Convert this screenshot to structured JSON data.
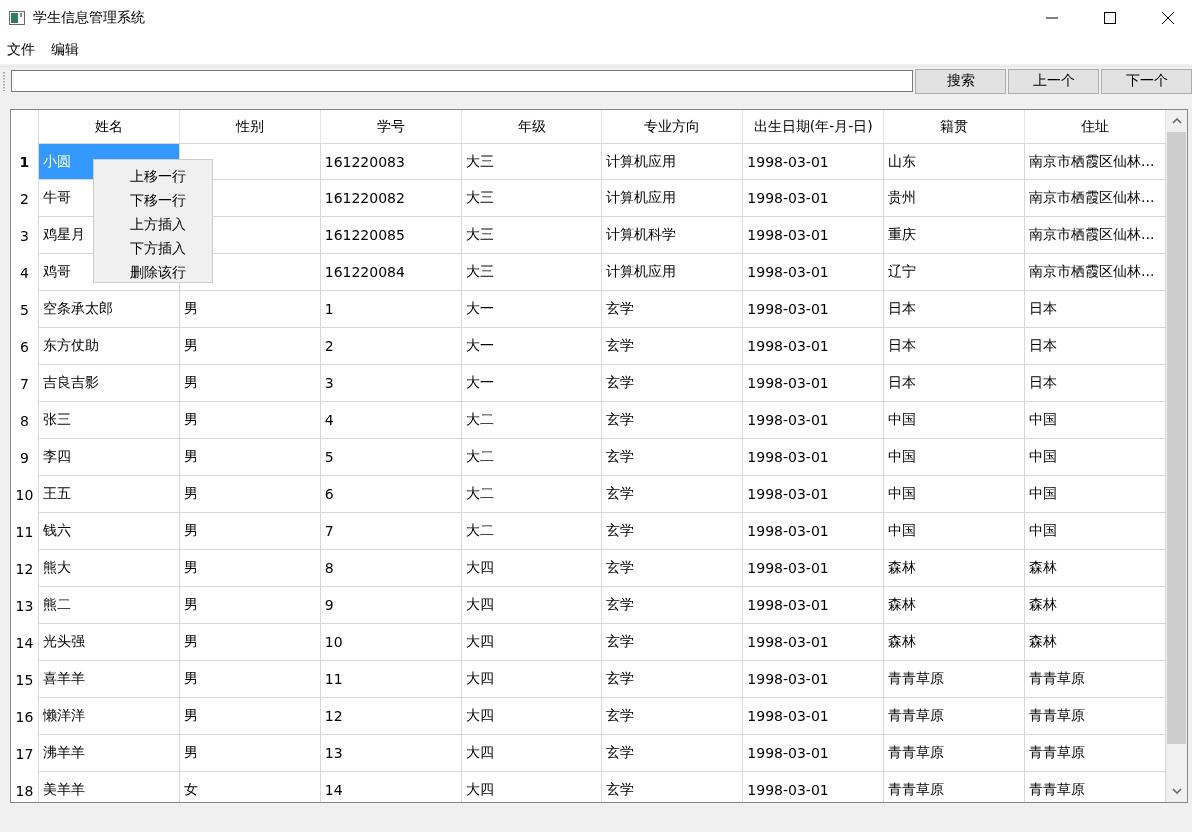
{
  "window": {
    "title": "学生信息管理系统"
  },
  "menu_bar": [
    "文件",
    "编辑"
  ],
  "toolbar": {
    "buttons": [
      "搜索",
      "上一个",
      "下一个"
    ]
  },
  "table": {
    "columns": [
      "姓名",
      "性别",
      "学号",
      "年级",
      "专业方向",
      "出生日期(年-月-日)",
      "籍贯",
      "住址"
    ],
    "rows": [
      {
        "number": "1",
        "selected": true,
        "cells": [
          "小圆",
          null,
          "161220083",
          "大三",
          "计算机应用",
          "1998-03-01",
          "山东",
          "南京市栖霞区仙林..."
        ]
      },
      {
        "number": "2",
        "selected": false,
        "cells": [
          "牛哥",
          null,
          "161220082",
          "大三",
          "计算机应用",
          "1998-03-01",
          "贵州",
          "南京市栖霞区仙林..."
        ]
      },
      {
        "number": "3",
        "selected": false,
        "cells": [
          "鸡星月",
          null,
          "161220085",
          "大三",
          "计算机科学",
          "1998-03-01",
          "重庆",
          "南京市栖霞区仙林..."
        ]
      },
      {
        "number": "4",
        "selected": false,
        "cells": [
          "鸡哥",
          null,
          "161220084",
          "大三",
          "计算机应用",
          "1998-03-01",
          "辽宁",
          "南京市栖霞区仙林..."
        ]
      },
      {
        "number": "5",
        "selected": false,
        "cells": [
          "空条承太郎",
          "男",
          "1",
          "大一",
          "玄学",
          "1998-03-01",
          "日本",
          "日本"
        ]
      },
      {
        "number": "6",
        "selected": false,
        "cells": [
          "东方仗助",
          "男",
          "2",
          "大一",
          "玄学",
          "1998-03-01",
          "日本",
          "日本"
        ]
      },
      {
        "number": "7",
        "selected": false,
        "cells": [
          "吉良吉影",
          "男",
          "3",
          "大一",
          "玄学",
          "1998-03-01",
          "日本",
          "日本"
        ]
      },
      {
        "number": "8",
        "selected": false,
        "cells": [
          "张三",
          "男",
          "4",
          "大二",
          "玄学",
          "1998-03-01",
          "中国",
          "中国"
        ]
      },
      {
        "number": "9",
        "selected": false,
        "cells": [
          "李四",
          "男",
          "5",
          "大二",
          "玄学",
          "1998-03-01",
          "中国",
          "中国"
        ]
      },
      {
        "number": "10",
        "selected": false,
        "cells": [
          "王五",
          "男",
          "6",
          "大二",
          "玄学",
          "1998-03-01",
          "中国",
          "中国"
        ]
      },
      {
        "number": "11",
        "selected": false,
        "cells": [
          "钱六",
          "男",
          "7",
          "大二",
          "玄学",
          "1998-03-01",
          "中国",
          "中国"
        ]
      },
      {
        "number": "12",
        "selected": false,
        "cells": [
          "熊大",
          "男",
          "8",
          "大四",
          "玄学",
          "1998-03-01",
          "森林",
          "森林"
        ]
      },
      {
        "number": "13",
        "selected": false,
        "cells": [
          "熊二",
          "男",
          "9",
          "大四",
          "玄学",
          "1998-03-01",
          "森林",
          "森林"
        ]
      },
      {
        "number": "14",
        "selected": false,
        "cells": [
          "光头强",
          "男",
          "10",
          "大四",
          "玄学",
          "1998-03-01",
          "森林",
          "森林"
        ]
      },
      {
        "number": "15",
        "selected": false,
        "cells": [
          "喜羊羊",
          "男",
          "11",
          "大四",
          "玄学",
          "1998-03-01",
          "青青草原",
          "青青草原"
        ]
      },
      {
        "number": "16",
        "selected": false,
        "cells": [
          "懒洋洋",
          "男",
          "12",
          "大四",
          "玄学",
          "1998-03-01",
          "青青草原",
          "青青草原"
        ]
      },
      {
        "number": "17",
        "selected": false,
        "cells": [
          "沸羊羊",
          "男",
          "13",
          "大四",
          "玄学",
          "1998-03-01",
          "青青草原",
          "青青草原"
        ]
      },
      {
        "number": "18",
        "selected": false,
        "cells": [
          "美羊羊",
          "女",
          "14",
          "大四",
          "玄学",
          "1998-03-01",
          "青青草原",
          "青青草原"
        ]
      }
    ]
  },
  "context_menu": {
    "items": [
      "上移一行",
      "下移一行",
      "上方插入",
      "下方插入",
      "删除该行"
    ]
  }
}
